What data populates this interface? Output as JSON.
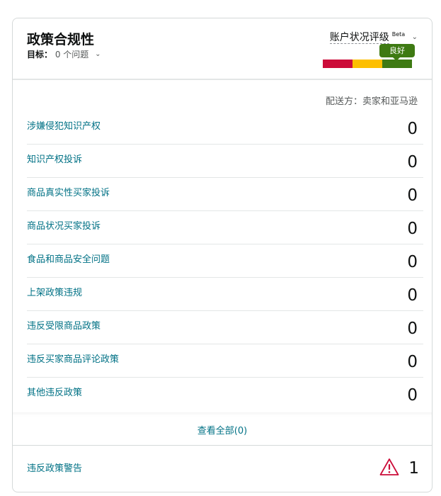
{
  "header": {
    "title": "政策合规性",
    "target_label": "目标：",
    "target_value": "0 个问题",
    "rating_label": "账户状况评级",
    "rating_tag": "Beta",
    "rating_status": "良好",
    "rating_colors": [
      "#cc0c39",
      "#fdbf00",
      "#3e7a13"
    ]
  },
  "fulfillment": "配送方：卖家和亚马逊",
  "rows": [
    {
      "label": "涉嫌侵犯知识产权",
      "count": "0"
    },
    {
      "label": "知识产权投诉",
      "count": "0"
    },
    {
      "label": "商品真实性买家投诉",
      "count": "0"
    },
    {
      "label": "商品状况买家投诉",
      "count": "0"
    },
    {
      "label": "食品和商品安全问题",
      "count": "0"
    },
    {
      "label": "上架政策违规",
      "count": "0"
    },
    {
      "label": "违反受限商品政策",
      "count": "0"
    },
    {
      "label": "违反买家商品评论政策",
      "count": "0"
    },
    {
      "label": "其他违反政策",
      "count": "0"
    }
  ],
  "view_all": "查看全部(0)",
  "warning": {
    "label": "违反政策警告",
    "count": "1",
    "icon": "warning-triangle-icon",
    "color": "#cc0c39"
  }
}
